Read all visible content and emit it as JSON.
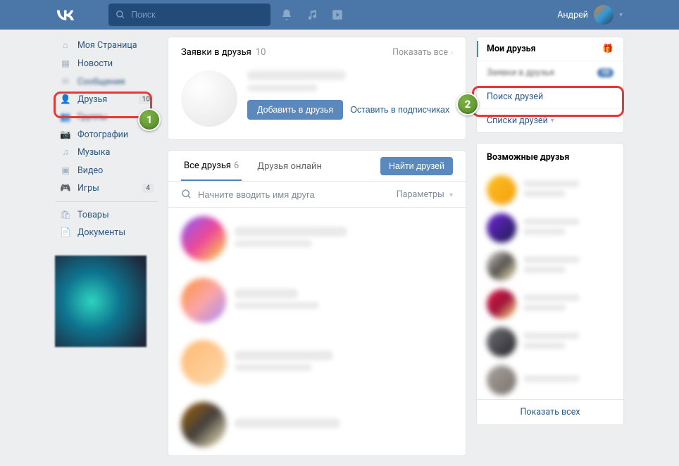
{
  "header": {
    "search_placeholder": "Поиск",
    "username": "Андрей"
  },
  "sidebar": {
    "items": [
      {
        "label": "Моя Страница",
        "icon": "home"
      },
      {
        "label": "Новости",
        "icon": "news"
      },
      {
        "label": "Сообщения",
        "icon": "msg"
      },
      {
        "label": "Друзья",
        "icon": "user",
        "badge": "10"
      },
      {
        "label": "Группы",
        "icon": "group"
      },
      {
        "label": "Фотографии",
        "icon": "photo"
      },
      {
        "label": "Музыка",
        "icon": "music"
      },
      {
        "label": "Видео",
        "icon": "video"
      },
      {
        "label": "Игры",
        "icon": "game",
        "badge": "4"
      }
    ],
    "secondary": [
      {
        "label": "Товары"
      },
      {
        "label": "Документы"
      }
    ]
  },
  "requests": {
    "title": "Заявки в друзья",
    "count": "10",
    "show_all": "Показать все",
    "add_button": "Добавить в друзья",
    "leave_sub": "Оставить в подписчиках"
  },
  "friends": {
    "tab_all": "Все друзья",
    "tab_all_count": "6",
    "tab_online": "Друзья онлайн",
    "find_button": "Найти друзей",
    "search_placeholder": "Начните вводить имя друга",
    "params": "Параметры"
  },
  "rmenu": {
    "my_friends": "Мои друзья",
    "requests": "Заявки в друзья",
    "search": "Поиск друзей",
    "lists": "Списки друзей"
  },
  "possible": {
    "title": "Возможные друзья",
    "show_all": "Показать всех"
  },
  "ann": {
    "step1": "1",
    "step2": "2"
  }
}
